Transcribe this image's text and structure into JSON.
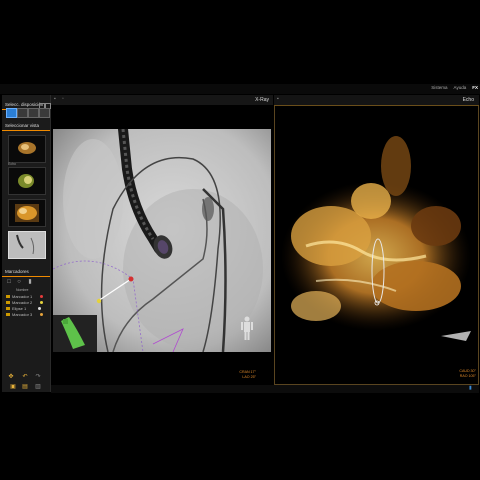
{
  "top_menu": [
    "Sistema",
    "Ayuda",
    "FX"
  ],
  "sidebar": {
    "display_title": "Selecc. disposición",
    "view_title": "Seleccionar vista",
    "markers_title": "Marcadores",
    "thumbnails": [
      {
        "label": ""
      },
      {
        "label": "Echo"
      },
      {
        "label": ""
      },
      {
        "label": ""
      }
    ],
    "marker_header": "Nombre",
    "markers": [
      {
        "label": "Marcador 1",
        "color": "#e53b3b"
      },
      {
        "label": "Marcador 2",
        "color": "#e5d23b"
      },
      {
        "label": "Elipse 1",
        "color": "#dddddd"
      },
      {
        "label": "Marcador 3",
        "color": "#e5a33b"
      }
    ]
  },
  "xray": {
    "title": "X-Ray",
    "angle_1": "CRAN 17°",
    "angle_2": "LAO 25°"
  },
  "echo": {
    "title": "Echo",
    "angle_1": "CAUD 30°",
    "angle_2": "RAO 105°"
  },
  "colors": {
    "accent": "#f08a00",
    "angle_text": "#e08a2a",
    "selected_layout": "#2b7fd6"
  }
}
